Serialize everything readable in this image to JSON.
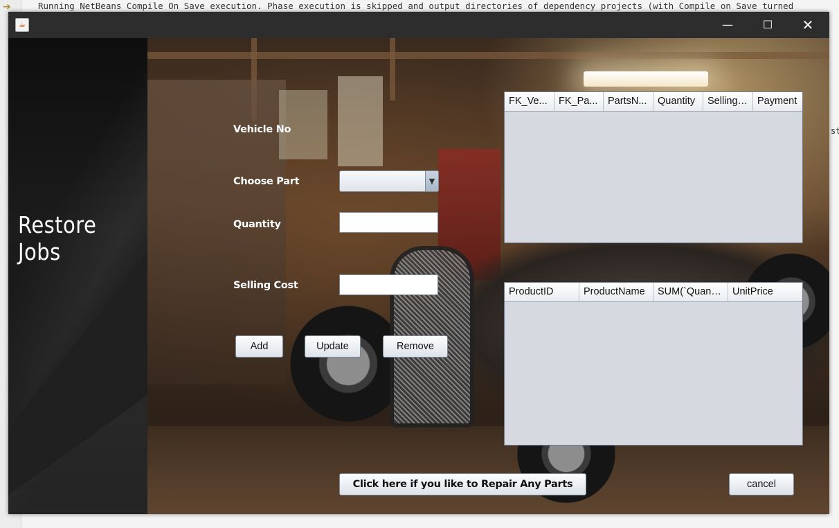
{
  "ide": {
    "output_line": "Running NetBeans Compile On Save execution. Phase execution is skipped and output directories of dependency projects (with Compile on Save turned",
    "side_fragment": "st"
  },
  "window": {
    "title": "",
    "controls": {
      "minimize": "—",
      "maximize": "☐",
      "close": "✕"
    }
  },
  "sidebar": {
    "title": "Restore Jobs"
  },
  "form": {
    "vehicle_label": "Vehicle No",
    "part_label": "Choose Part",
    "part_selected": "",
    "quantity_label": "Quantity",
    "quantity_value": "",
    "selling_cost_label": "Selling Cost",
    "selling_cost_value": ""
  },
  "buttons": {
    "add": "Add",
    "update": "Update",
    "remove": "Remove",
    "repair": "Click here if you like to Repair  Any Parts",
    "cancel": "cancel"
  },
  "jobs_table": {
    "columns": [
      "FK_Ve...",
      "FK_Pa...",
      "PartsN...",
      "Quantity",
      "Selling ...",
      "Payment"
    ],
    "rows": []
  },
  "parts_table": {
    "columns": [
      "ProductID",
      "ProductName",
      "SUM(`Quanti...",
      "UnitPrice"
    ],
    "rows": []
  }
}
